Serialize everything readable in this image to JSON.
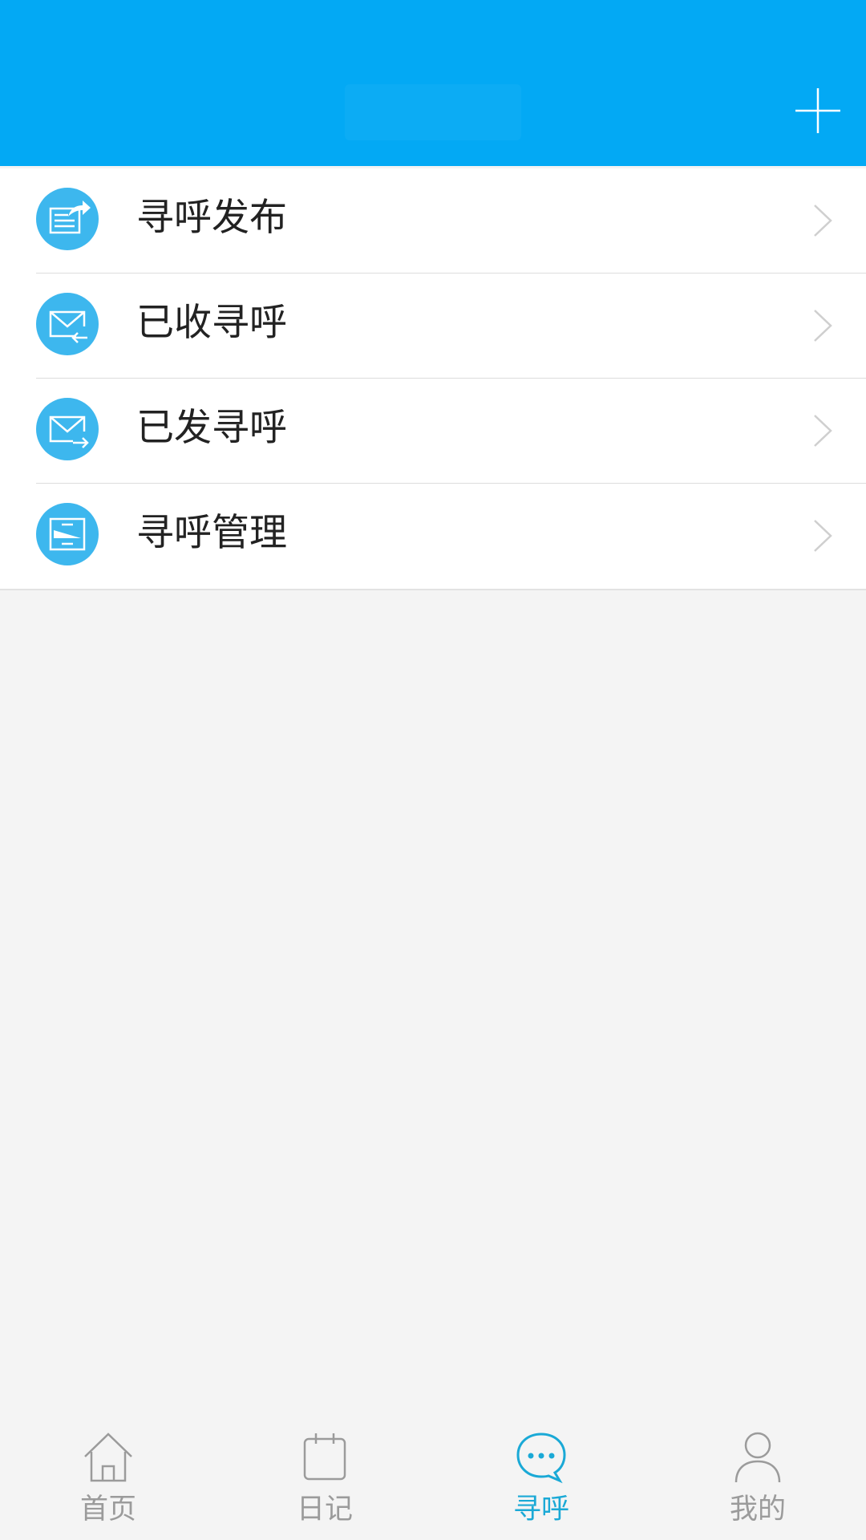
{
  "colors": {
    "header": "#03a9f4",
    "icon_bg": "#3db7ee",
    "tab_active": "#1aa9d6",
    "tab_inactive": "#9b9b9b"
  },
  "header": {
    "add_icon": "plus-icon"
  },
  "menu": {
    "items": [
      {
        "label": "寻呼发布",
        "icon": "publish-icon"
      },
      {
        "label": "已收寻呼",
        "icon": "inbox-mail-icon"
      },
      {
        "label": "已发寻呼",
        "icon": "sent-mail-icon"
      },
      {
        "label": "寻呼管理",
        "icon": "manage-icon"
      }
    ]
  },
  "tabbar": {
    "active": 2,
    "tabs": [
      {
        "label": "首页",
        "icon": "home-icon"
      },
      {
        "label": "日记",
        "icon": "calendar-icon"
      },
      {
        "label": "寻呼",
        "icon": "chat-bubble-icon"
      },
      {
        "label": "我的",
        "icon": "person-icon"
      }
    ]
  }
}
